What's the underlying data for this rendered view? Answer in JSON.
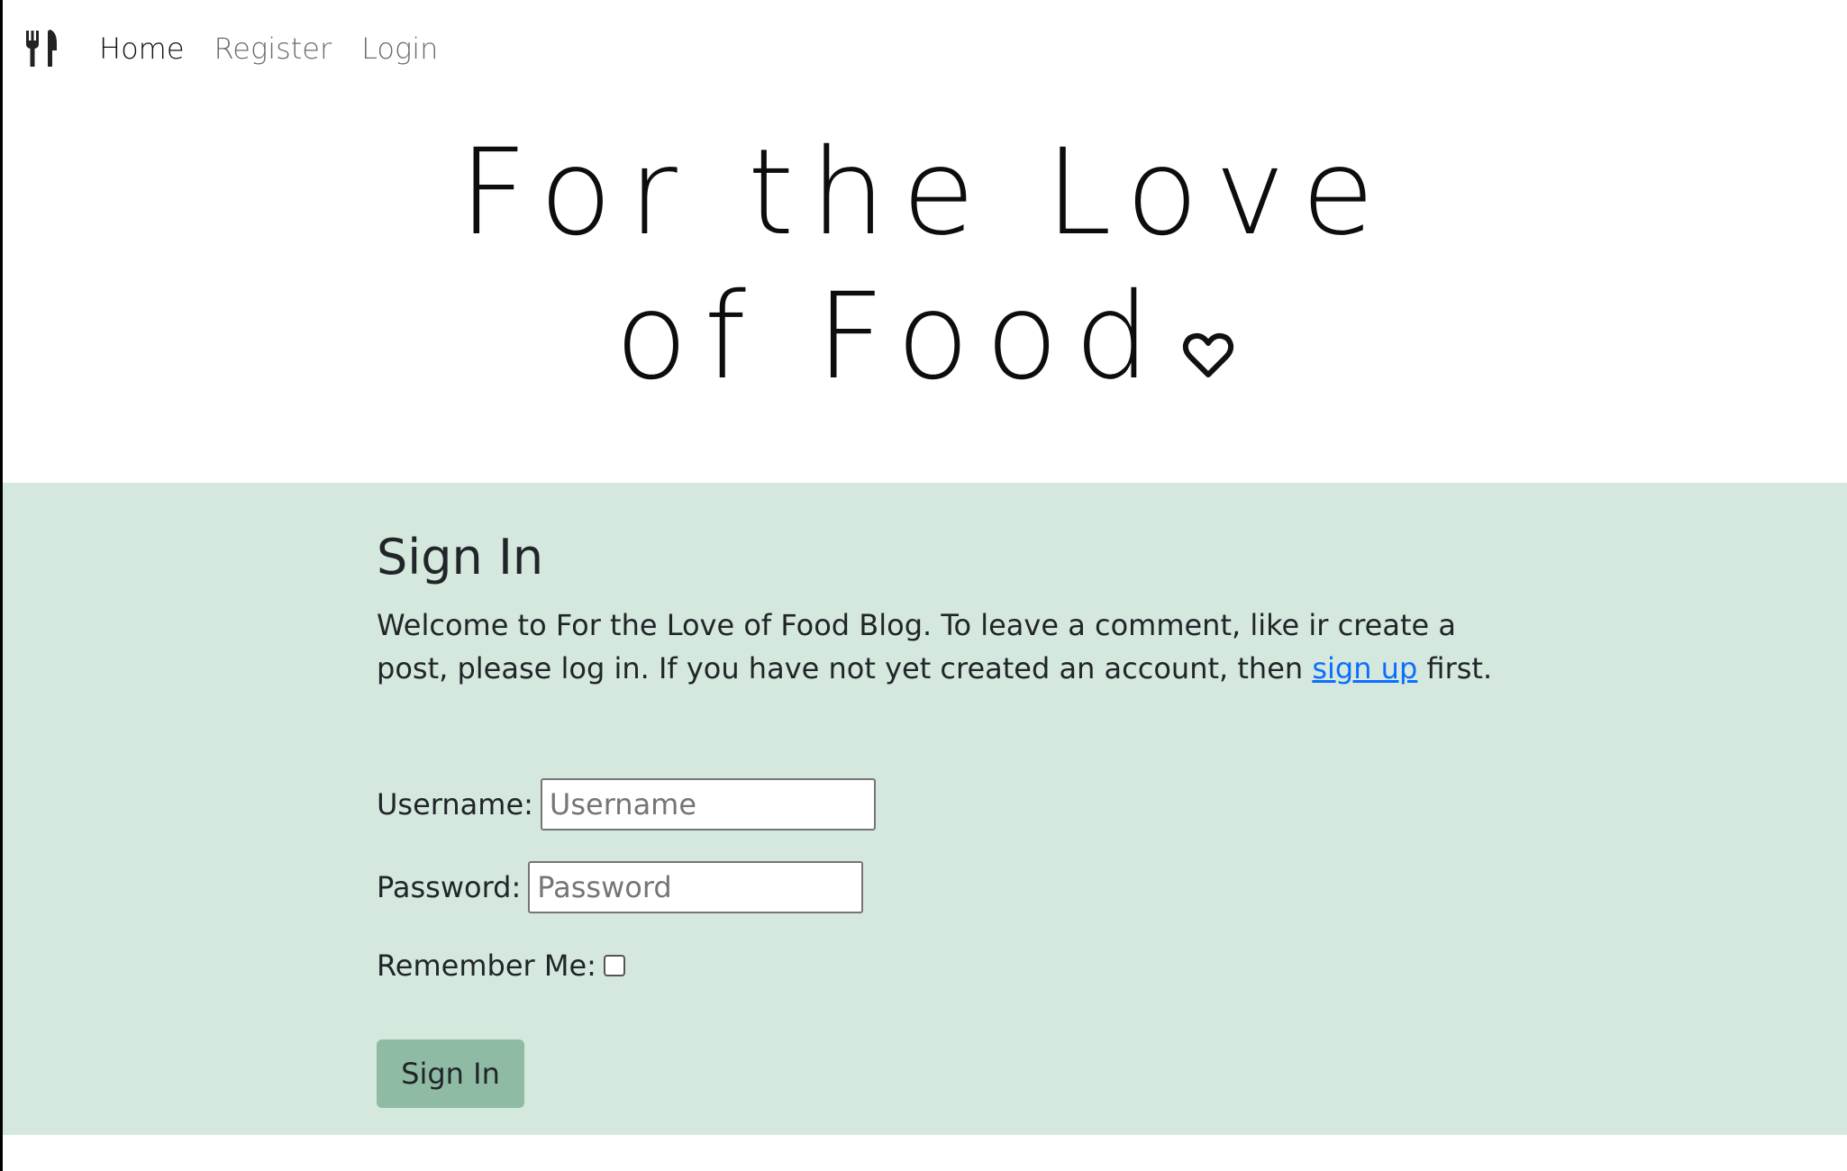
{
  "nav": {
    "brand_icon": "fork-knife-icon",
    "links": [
      {
        "label": "Home",
        "active": true
      },
      {
        "label": "Register",
        "active": false
      },
      {
        "label": "Login",
        "active": false
      }
    ]
  },
  "hero": {
    "title": "For the Love of Food",
    "icon": "heart-icon"
  },
  "signin": {
    "title": "Sign In",
    "intro_text": "Welcome to For the Love of Food Blog. To leave a comment, like ir create a post, please log in. If you have not yet created an account, then ",
    "signup_link": "sign up",
    "intro_suffix": " first.",
    "username_label": "Username:",
    "username_placeholder": "Username",
    "password_label": "Password:",
    "password_placeholder": "Password",
    "remember_label": "Remember Me:",
    "remember_checked": false,
    "submit_label": "Sign In"
  },
  "colors": {
    "section_bg": "#d4e8dd",
    "button_bg": "#8fbba5",
    "link": "#0d6efd"
  }
}
